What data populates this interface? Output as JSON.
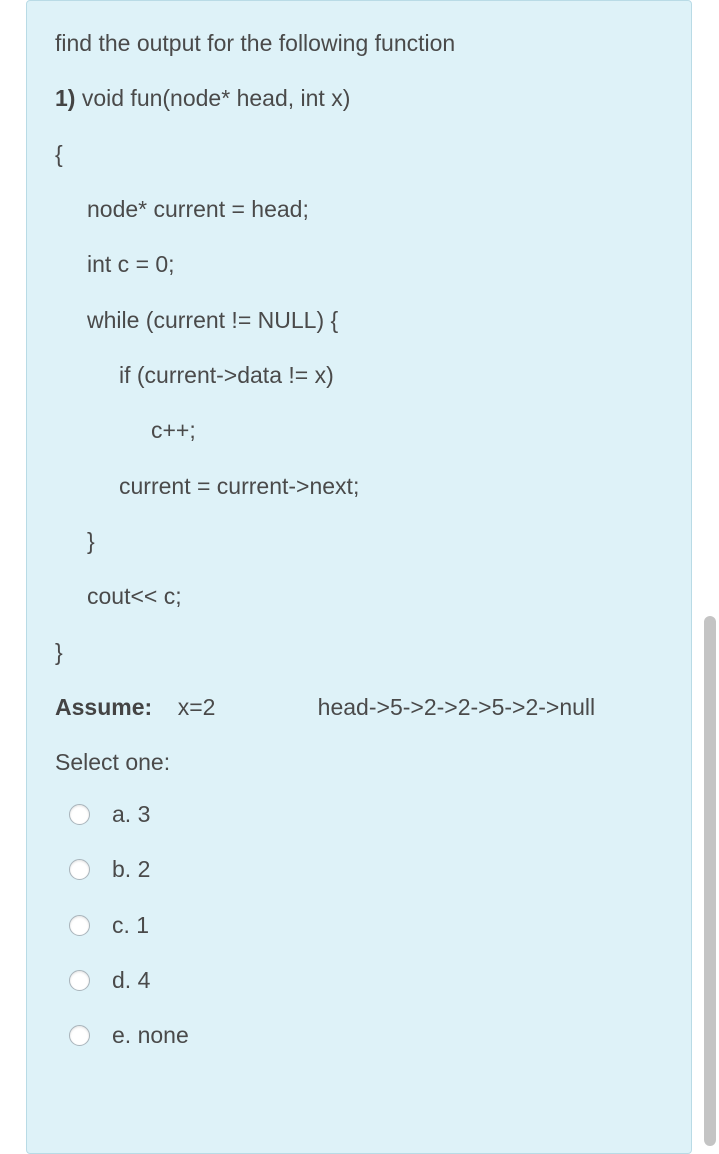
{
  "question": {
    "prompt": "find the output for the following function",
    "number_prefix": "1)",
    "signature": " void fun(node* head, int x)",
    "code_lines": [
      {
        "text": "{",
        "indent": 0
      },
      {
        "text": "node* current = head;",
        "indent": 1
      },
      {
        "text": "int c = 0;",
        "indent": 1
      },
      {
        "text": "while (current != NULL) {",
        "indent": 1
      },
      {
        "text": "if (current->data != x)",
        "indent": 2
      },
      {
        "text": "c++;",
        "indent": 3
      },
      {
        "text": "current = current->next;",
        "indent": 2
      },
      {
        "text": "}",
        "indent": 1
      },
      {
        "text": "cout<< c;",
        "indent": 1
      },
      {
        "text": "}",
        "indent": 0
      }
    ],
    "assume_label": "Assume:",
    "assume_text": "    x=2                head->5->2->2->5->2->null"
  },
  "select_one": "Select one:",
  "options": [
    {
      "id": "a",
      "label": "a. 3"
    },
    {
      "id": "b",
      "label": "b. 2"
    },
    {
      "id": "c",
      "label": "c. 1"
    },
    {
      "id": "d",
      "label": "d. 4"
    },
    {
      "id": "e",
      "label": "e. none"
    }
  ]
}
